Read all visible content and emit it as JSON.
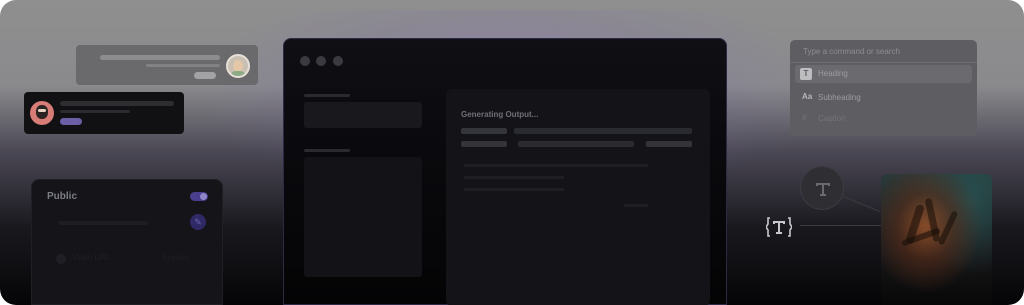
{
  "comments": {
    "top_avatar": "person-avatar",
    "second_avatar": "person-avatar"
  },
  "visibility_card": {
    "title": "Public",
    "toggle_on": true,
    "video_label": "Video URL",
    "access_label": "Anyone"
  },
  "main_window": {
    "output_title": "Generating Output..."
  },
  "command_palette": {
    "placeholder": "Type a command or search",
    "items": [
      {
        "icon": "T",
        "label": "Heading"
      },
      {
        "icon": "Aa",
        "label": "Subheading"
      },
      {
        "icon": "#",
        "label": "Caption"
      }
    ]
  },
  "colors": {
    "accent": "#4a3f8c",
    "accent_light": "#8f86c9"
  }
}
